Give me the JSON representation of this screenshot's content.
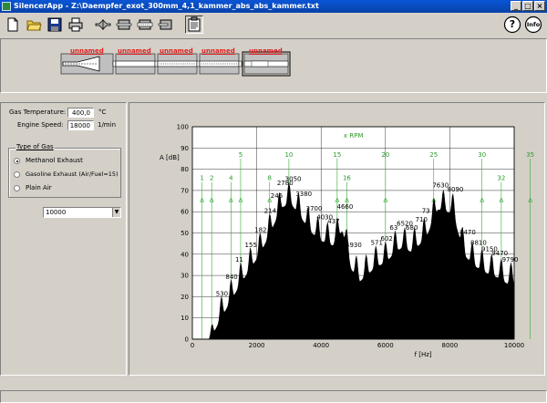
{
  "window": {
    "title": "SilencerApp - Z:\\Daempfer_exot_300mm_4,1_kammer_abs_abs_kammer.txt",
    "minimize": "_",
    "maximize": "□",
    "close": "×"
  },
  "toolbar": {
    "help": "?",
    "info": "Info"
  },
  "muffler": {
    "chamber_labels": [
      "unnamed",
      "unnamed",
      "unnamed",
      "unnamed",
      "unnamed"
    ]
  },
  "settings": {
    "gas_temperature_label": "Gas Temperature:",
    "gas_temperature_value": "400,0",
    "gas_temperature_unit": "°C",
    "engine_speed_label": "Engine Speed:",
    "engine_speed_value": "18000",
    "engine_speed_unit": "1/min",
    "gas_type_title": "Type of Gas",
    "gas_options": [
      "Methanol Exhaust",
      "Gasoline Exhaust (Air/Fuel=15)",
      "Plain Air"
    ],
    "gas_selected": "Methanol Exhaust",
    "combo_value": "10000"
  },
  "chart_data": {
    "type": "area",
    "xlabel": "f [Hz]",
    "ylabel": "A [dB]",
    "top_axis_label": "x RPM",
    "xlim": [
      0,
      10000
    ],
    "ylim": [
      0,
      100
    ],
    "x_ticks": [
      "0",
      "2000",
      "4000",
      "6000",
      "8000",
      "10000"
    ],
    "y_ticks": [
      "0",
      "10",
      "20",
      "30",
      "40",
      "50",
      "60",
      "70",
      "80",
      "90",
      "100"
    ],
    "grid": true,
    "fill_color": "#000000",
    "order_line_color": "#33aa33",
    "harmonic_step_hz": 300,
    "order_labels": [
      {
        "order": 1,
        "label": "1",
        "y": 74
      },
      {
        "order": 2,
        "label": "2",
        "y": 74
      },
      {
        "order": 4,
        "label": "4",
        "y": 74
      },
      {
        "order": 5,
        "label": "5",
        "y": 85
      },
      {
        "order": 8,
        "label": "8",
        "y": 74
      },
      {
        "order": 10,
        "label": "10",
        "y": 85
      },
      {
        "order": 15,
        "label": "15",
        "y": 85
      },
      {
        "order": 16,
        "label": "16",
        "y": 74
      },
      {
        "order": 20,
        "label": "20",
        "y": 85
      },
      {
        "order": 25,
        "label": "25",
        "y": 85
      },
      {
        "order": 30,
        "label": "30",
        "y": 85
      },
      {
        "order": 32,
        "label": "32",
        "y": 74
      },
      {
        "order": 35,
        "label": "35",
        "y": 85
      }
    ],
    "order_marker_y": 66,
    "peaks": [
      {
        "x": 600,
        "y": 11,
        "label": ""
      },
      {
        "x": 900,
        "y": 20,
        "label": "530"
      },
      {
        "x": 1200,
        "y": 28,
        "label": "840"
      },
      {
        "x": 1500,
        "y": 36,
        "label": "11"
      },
      {
        "x": 1800,
        "y": 43,
        "label": "155"
      },
      {
        "x": 2100,
        "y": 50,
        "label": "182"
      },
      {
        "x": 2400,
        "y": 59,
        "label": "214"
      },
      {
        "x": 2600,
        "y": 66,
        "label": "246"
      },
      {
        "x": 2800,
        "y": 72,
        "label": "2780"
      },
      {
        "x": 3050,
        "y": 74,
        "label": "3050"
      },
      {
        "x": 3380,
        "y": 67,
        "label": "3380"
      },
      {
        "x": 3700,
        "y": 60,
        "label": "3700"
      },
      {
        "x": 4030,
        "y": 56,
        "label": "4030"
      },
      {
        "x": 4370,
        "y": 54,
        "label": "437"
      },
      {
        "x": 4660,
        "y": 61,
        "label": "4660"
      },
      {
        "x": 4930,
        "y": 43,
        "label": "4930"
      },
      {
        "x": 5200,
        "y": 37,
        "label": ""
      },
      {
        "x": 5710,
        "y": 44,
        "label": "571"
      },
      {
        "x": 6020,
        "y": 46,
        "label": "602"
      },
      {
        "x": 6300,
        "y": 51,
        "label": "63"
      },
      {
        "x": 6520,
        "y": 53,
        "label": "6520"
      },
      {
        "x": 6800,
        "y": 51,
        "label": "680"
      },
      {
        "x": 7100,
        "y": 55,
        "label": "710"
      },
      {
        "x": 7300,
        "y": 59,
        "label": "73"
      },
      {
        "x": 7630,
        "y": 71,
        "label": "7630"
      },
      {
        "x": 8090,
        "y": 69,
        "label": "8090"
      },
      {
        "x": 8470,
        "y": 49,
        "label": "8470"
      },
      {
        "x": 8810,
        "y": 44,
        "label": "8810"
      },
      {
        "x": 9150,
        "y": 41,
        "label": "9150"
      },
      {
        "x": 9470,
        "y": 39,
        "label": "9470"
      },
      {
        "x": 9790,
        "y": 36,
        "label": "9790"
      }
    ]
  }
}
